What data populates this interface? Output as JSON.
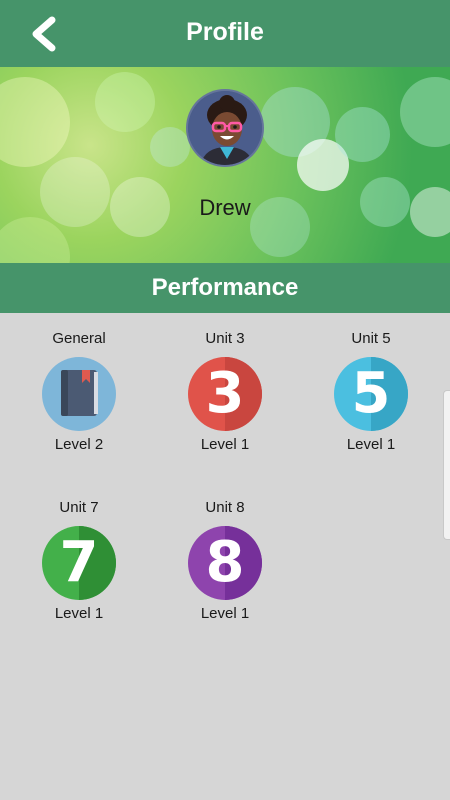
{
  "header": {
    "title": "Profile",
    "back_icon": "chevron-left-icon"
  },
  "profile": {
    "name": "Drew",
    "avatar_icon": "avatar-girl-icon"
  },
  "section": {
    "title": "Performance"
  },
  "units": [
    {
      "name": "General",
      "level": "Level 2",
      "badge": "book-icon",
      "color": "#7eb6d9"
    },
    {
      "name": "Unit 3",
      "level": "Level 1",
      "badge_text": "3",
      "color": "#e0534a",
      "shade": "#c9463f"
    },
    {
      "name": "Unit 5",
      "level": "Level 1",
      "badge_text": "5",
      "color": "#4bbfe0",
      "shade": "#37a6c6"
    },
    {
      "name": "Unit 7",
      "level": "Level 1",
      "badge_text": "7",
      "color": "#43b04a",
      "shade": "#2f8f35"
    },
    {
      "name": "Unit 8",
      "level": "Level 1",
      "badge_text": "8",
      "color": "#8e44ad",
      "shade": "#76309a"
    }
  ],
  "colors": {
    "primary": "#46946a",
    "background": "#d6d6d6"
  }
}
